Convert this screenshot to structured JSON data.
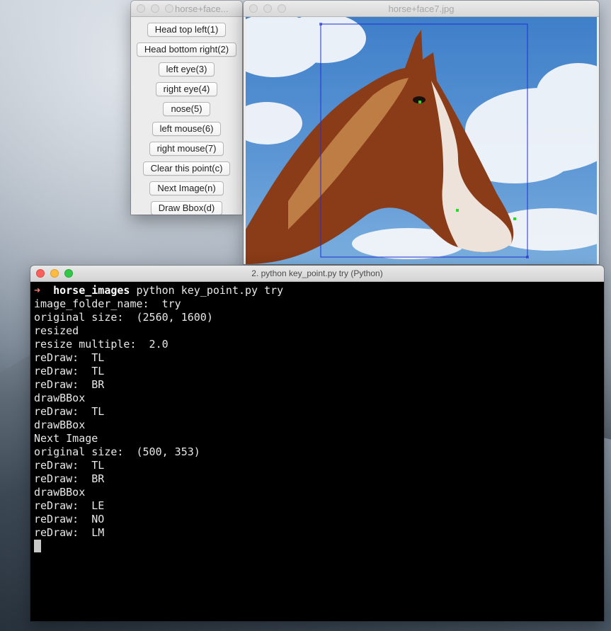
{
  "tool_window": {
    "title": "horse+face...",
    "buttons": [
      "Head top left(1)",
      "Head bottom right(2)",
      "left eye(3)",
      "right eye(4)",
      "nose(5)",
      "left mouse(6)",
      "right mouse(7)",
      "Clear this point(c)",
      "Next Image(n)",
      "Draw Bbox(d)"
    ]
  },
  "image_window": {
    "title": "horse+face7.jpg",
    "bbox_color": "#1f2fd6",
    "point_color": "#22dd22"
  },
  "terminal": {
    "title": "2. python key_point.py try (Python)",
    "prompt_arrow": "➜",
    "prompt_dir": "horse_images",
    "prompt_command": " python key_point.py try",
    "lines": [
      "image_folder_name:  try",
      "original size:  (2560, 1600)",
      "resized",
      "resize multiple:  2.0",
      "reDraw:  TL",
      "reDraw:  TL",
      "reDraw:  BR",
      "drawBBox",
      "reDraw:  TL",
      "drawBBox",
      "Next Image",
      "original size:  (500, 353)",
      "reDraw:  TL",
      "reDraw:  BR",
      "drawBBox",
      "reDraw:  LE",
      "reDraw:  NO",
      "reDraw:  LM"
    ]
  }
}
